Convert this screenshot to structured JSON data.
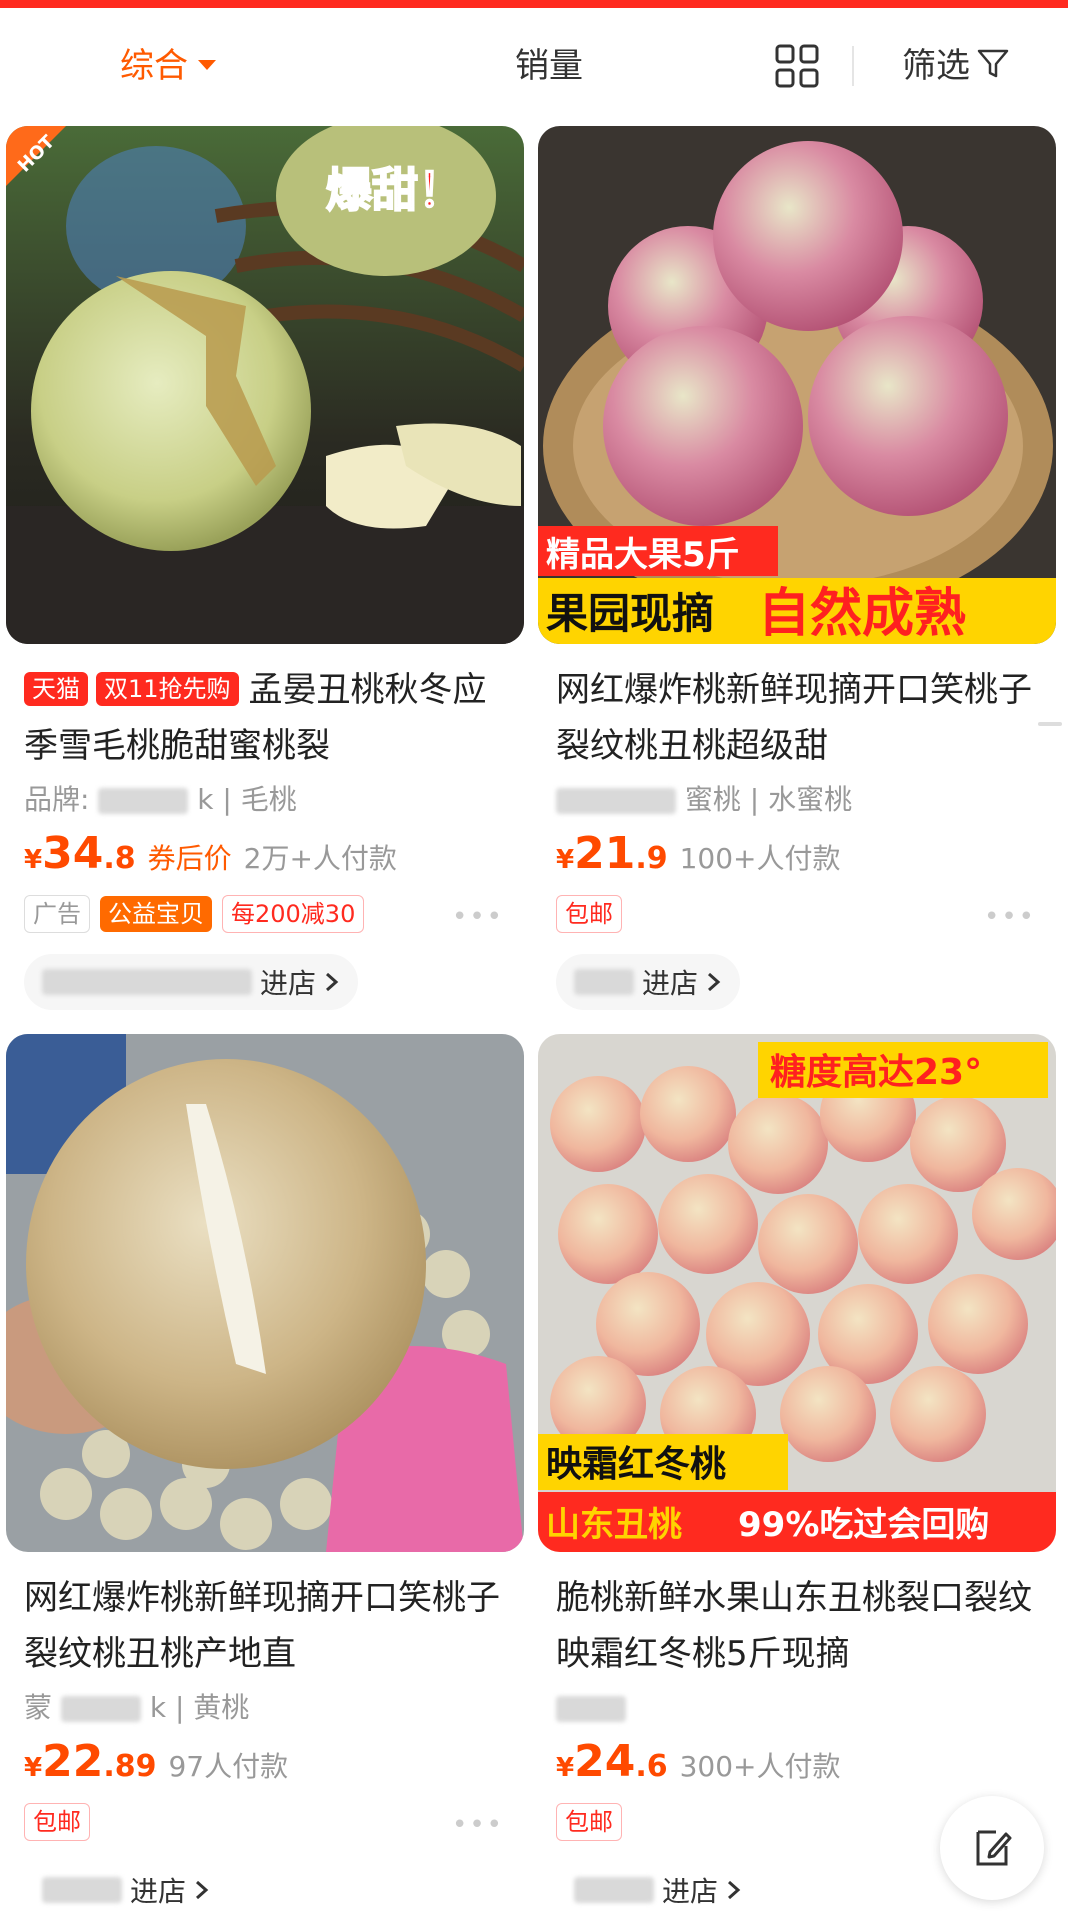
{
  "sort_bar": {
    "comprehensive": "综合",
    "sales": "销量",
    "filter": "筛选"
  },
  "products": [
    {
      "image": {
        "badge_hot": "HOT",
        "overlay_text": "爆甜！"
      },
      "tag_tmall": "天猫",
      "tag_double11": "双11抢先购",
      "title": "孟晏丑桃秋冬应季雪毛桃脆甜蜜桃裂",
      "brand_prefix": "品牌:",
      "brand_suffix": "k | 毛桃",
      "price": {
        "currency": "¥",
        "integer": "34",
        "decimal": ".8"
      },
      "after_coupon": "券后价",
      "sold": "2万+人付款",
      "badges": [
        "广告",
        "公益宝贝",
        "每200减30"
      ],
      "more": "•••",
      "enter_store": "进店"
    },
    {
      "image": {
        "banner_top": "精品大果5斤",
        "banner_left": "果园现摘",
        "banner_right": "自然成熟"
      },
      "title": "网红爆炸桃新鲜现摘开口笑桃子裂纹桃丑桃超级甜",
      "brand_suffix": "蜜桃 | 水蜜桃",
      "price": {
        "currency": "¥",
        "integer": "21",
        "decimal": ".9"
      },
      "sold": "100+人付款",
      "badges": [
        "包邮"
      ],
      "more": "•••",
      "enter_store": "进店"
    },
    {
      "title": "网红爆炸桃新鲜现摘开口笑桃子裂纹桃丑桃产地直",
      "brand_prefix": "蒙",
      "brand_suffix": "k | 黄桃",
      "price": {
        "currency": "¥",
        "integer": "22",
        "decimal": ".89"
      },
      "sold": "97人付款",
      "badges": [
        "包邮"
      ],
      "more": "•••",
      "enter_store": "进店"
    },
    {
      "image": {
        "banner_top": "糖度高达23°",
        "banner_mid": "映霜红冬桃",
        "banner_left": "山东丑桃",
        "banner_right": "99%吃过会回购"
      },
      "title": "脆桃新鲜水果山东丑桃裂口裂纹映霜红冬桃5斤现摘",
      "price": {
        "currency": "¥",
        "integer": "24",
        "decimal": ".6"
      },
      "sold": "300+人付款",
      "badges": [
        "包邮"
      ],
      "more": "•••",
      "enter_store": "进店"
    }
  ],
  "colors": {
    "accent": "#ff5a00",
    "price": "#ff4a00",
    "tmall_red": "#ff2a1f"
  },
  "icons": [
    "grid-view-icon",
    "filter-funnel-icon",
    "chevron-right-icon",
    "write-note-icon"
  ]
}
